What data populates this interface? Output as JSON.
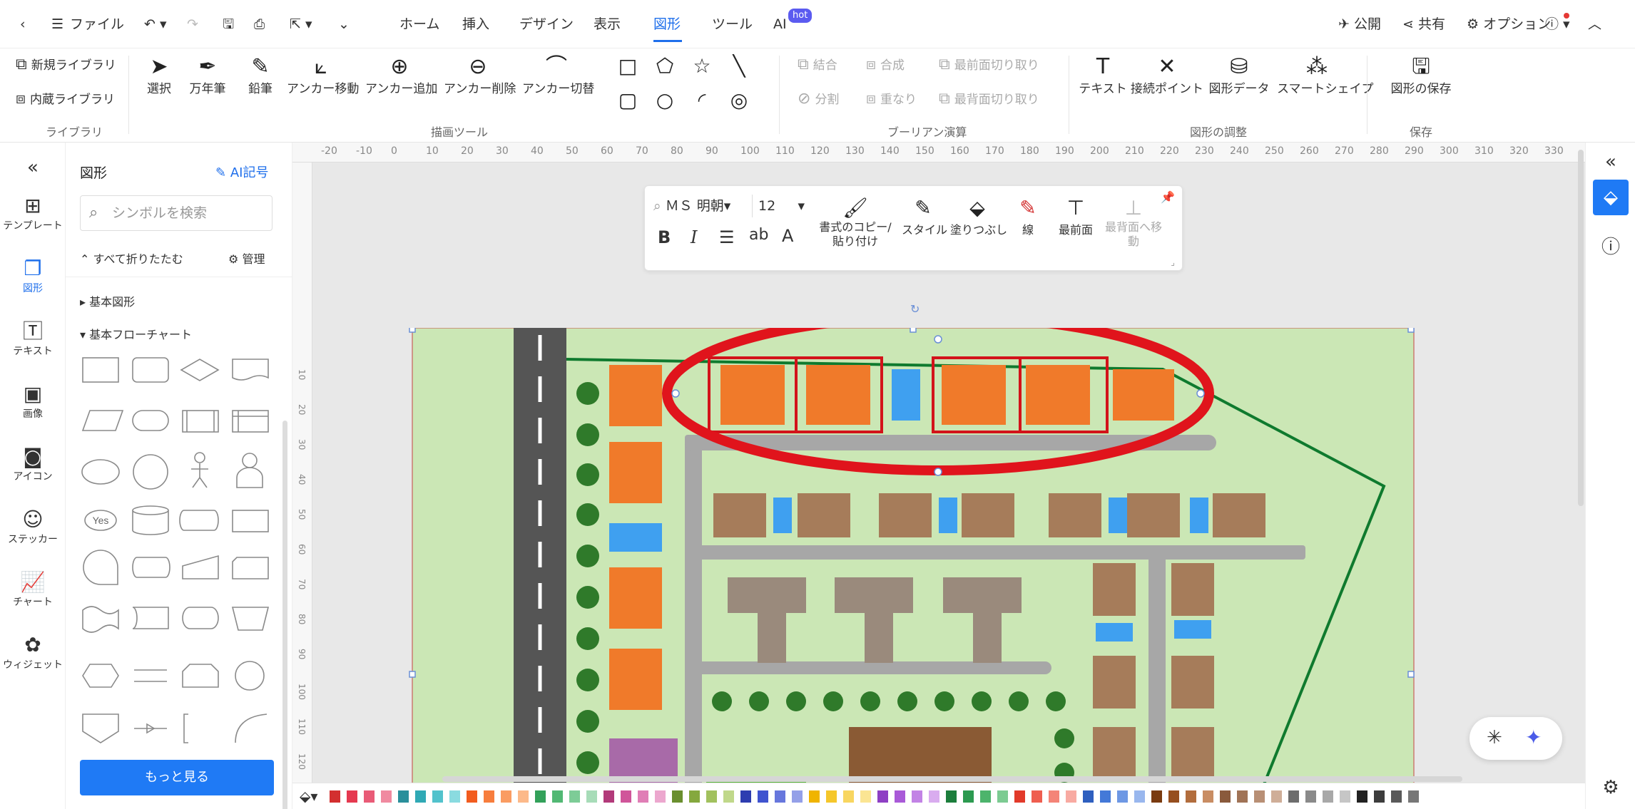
{
  "menubar": {
    "file_label": "ファイル",
    "tabs": [
      "ホーム",
      "挿入",
      "デザイン",
      "表示",
      "図形",
      "ツール",
      "AI"
    ],
    "active_tab": "図形",
    "hot_badge": "hot",
    "publish": "公開",
    "share": "共有",
    "options": "オプション"
  },
  "ribbon": {
    "library": {
      "new": "新規ライブラリ",
      "builtin": "内蔵ライブラリ",
      "group": "ライブラリ"
    },
    "drawing": {
      "select": "選択",
      "pen": "万年筆",
      "pencil": "鉛筆",
      "anchor_move": "アンカー移動",
      "anchor_add": "アンカー追加",
      "anchor_delete": "アンカー削除",
      "anchor_toggle": "アンカー切替",
      "group": "描画ツール"
    },
    "boolean": {
      "union": "結合",
      "combine": "合成",
      "front_cut": "最前面切り取り",
      "split": "分割",
      "overlap": "重なり",
      "back_cut": "最背面切り取り",
      "group": "ブーリアン演算"
    },
    "shape_edit": {
      "text": "テキスト",
      "connect": "接続ポイント",
      "data": "図形データ",
      "smart": "スマートシェイプ",
      "group": "図形の調整"
    },
    "save": {
      "save_shape": "図形の保存",
      "group": "保存"
    }
  },
  "rail": {
    "items": [
      "テンプレート",
      "図形",
      "テキスト",
      "画像",
      "アイコン",
      "ステッカー",
      "チャート",
      "ウィジェット"
    ],
    "active": "図形"
  },
  "library": {
    "title": "図形",
    "ai_label": "AI記号",
    "search_placeholder": "シンボルを検索",
    "collapse_all": "すべて折りたたむ",
    "manage": "管理",
    "category_basic": "基本図形",
    "category_flow": "基本フローチャート",
    "yes_label": "Yes",
    "more_button": "もっと見る"
  },
  "ruler": {
    "top_ticks": [
      "-20",
      "-10",
      "0",
      "10",
      "20",
      "30",
      "40",
      "50",
      "60",
      "70",
      "80",
      "90",
      "100",
      "110",
      "120",
      "130",
      "140",
      "150",
      "160",
      "170",
      "180",
      "190",
      "200",
      "210",
      "220",
      "230",
      "240",
      "250",
      "260",
      "270",
      "280",
      "290",
      "300",
      "310",
      "320",
      "330"
    ],
    "left_ticks": [
      "10",
      "20",
      "30",
      "40",
      "50",
      "60",
      "70",
      "80",
      "90",
      "100",
      "110",
      "120"
    ]
  },
  "text_toolbar": {
    "font": "ＭＳ 明朝",
    "size": "12",
    "format_copy": "書式のコピー/貼り付け",
    "style": "スタイル",
    "fill": "塗りつぶし",
    "line": "線",
    "bring_front": "最前面",
    "send_back": "最背面へ移動"
  },
  "colors": {
    "accent": "#1f7af5",
    "highlight_ellipse": "#e0141c",
    "boundary_line": "#0f7a2e",
    "grass": "#c8e6b0",
    "road": "#555555",
    "roof_orange": "#f07a2a",
    "roof_brown": "#a67c5a",
    "pool": "#3fa0f0"
  },
  "palette": [
    "#d32f2f",
    "#e53950",
    "#e95b77",
    "#f08aa0",
    "#2a8f9b",
    "#30a9b5",
    "#52c2cc",
    "#8adbe0",
    "#f25c1f",
    "#f77d3d",
    "#fa9c62",
    "#fcb98a",
    "#33a15a",
    "#52b874",
    "#7dcc97",
    "#a7dcb8",
    "#b23a7a",
    "#d0559a",
    "#e07eb6",
    "#eca7ce",
    "#6a8f2f",
    "#85a83e",
    "#a2c15e",
    "#c0d88a",
    "#2d3db0",
    "#3f53cf",
    "#6777dd",
    "#94a0e8",
    "#f0b400",
    "#f5c72b",
    "#f8d660",
    "#fbe593",
    "#8e3fc4",
    "#a95ad8",
    "#c283e5",
    "#d9acef",
    "#1c7e3c",
    "#2c9a50",
    "#4db46c",
    "#7ccb92",
    "#e23a2a",
    "#ef5e50",
    "#f48478",
    "#f8aaa2",
    "#2e5fbf",
    "#4479d8",
    "#6e98e4",
    "#99b7ee",
    "#7a3b10",
    "#964f1f",
    "#b26d3d",
    "#c98d63",
    "#8a5a3c",
    "#a07356",
    "#b88f75",
    "#cfae98",
    "#6d6d6d",
    "#8a8a8a",
    "#a8a8a8",
    "#c6c6c6",
    "#222222",
    "#3d3d3d",
    "#5a5a5a",
    "#777777"
  ]
}
